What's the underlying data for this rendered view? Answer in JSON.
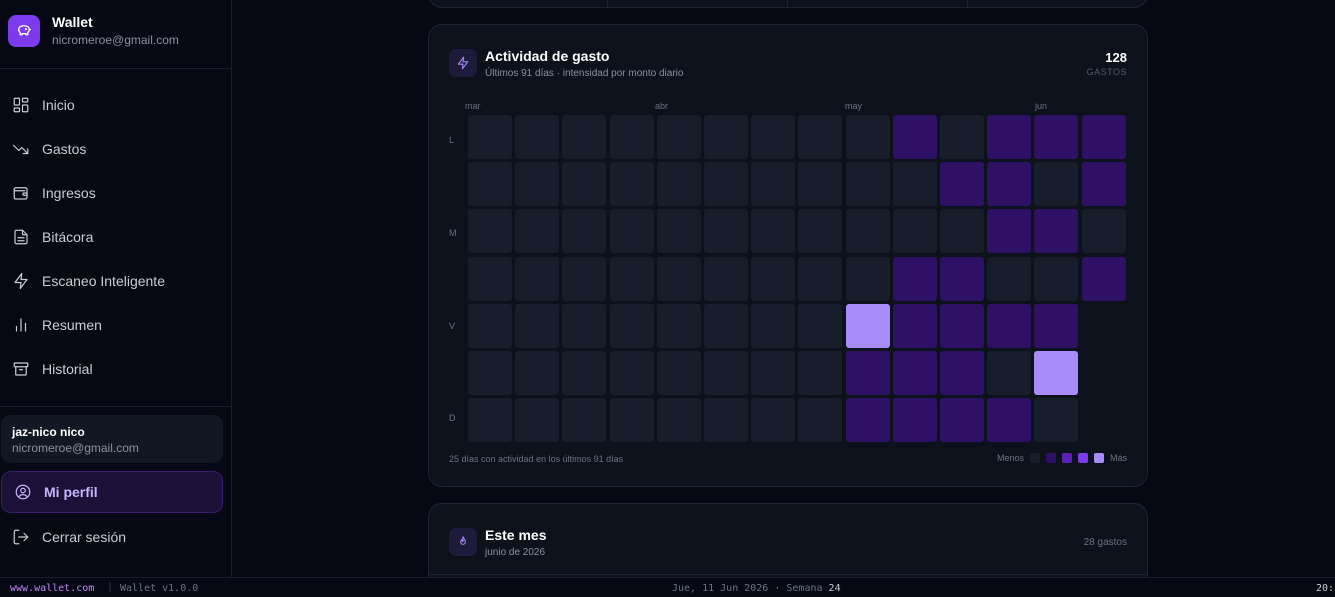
{
  "app": {
    "title": "Wallet",
    "email": "nicromeroe@gmail.com"
  },
  "nav": {
    "items": [
      {
        "label": "Inicio",
        "icon": "grid-icon"
      },
      {
        "label": "Gastos",
        "icon": "trending-down-icon"
      },
      {
        "label": "Ingresos",
        "icon": "wallet-icon"
      },
      {
        "label": "Bitácora",
        "icon": "file-text-icon"
      },
      {
        "label": "Escaneo Inteligente",
        "icon": "bolt-icon"
      },
      {
        "label": "Resumen",
        "icon": "bar-chart-icon"
      },
      {
        "label": "Historial",
        "icon": "archive-icon"
      }
    ]
  },
  "user": {
    "name": "jaz-nico nico",
    "email": "nicromeroe@gmail.com"
  },
  "profile_label": "Mi perfil",
  "logout_label": "Cerrar sesión",
  "activity": {
    "title": "Actividad de gasto",
    "subtitle": "Últimos 91 días · intensidad por monto diario",
    "count": "128",
    "count_label": "GASTOS",
    "months": [
      "mar",
      "abr",
      "may",
      "jun"
    ],
    "day_labels": [
      "L",
      "M",
      "V",
      "D"
    ],
    "footer": "25 días con actividad en los últimos 91 días",
    "legend_less": "Menos",
    "legend_more": "Más",
    "colors": {
      "empty": "#171d2a",
      "level1": "#2e1065",
      "level2": "#5b21b6",
      "level3": "#7c3aed",
      "level4": "#a78bfa"
    },
    "grid": [
      [
        0,
        0,
        0,
        0,
        0,
        0,
        0,
        0,
        0,
        1,
        0,
        1,
        1,
        1
      ],
      [
        0,
        0,
        0,
        0,
        0,
        0,
        0,
        0,
        0,
        0,
        1,
        1,
        0,
        1
      ],
      [
        0,
        0,
        0,
        0,
        0,
        0,
        0,
        0,
        0,
        0,
        0,
        1,
        1,
        0
      ],
      [
        0,
        0,
        0,
        0,
        0,
        0,
        0,
        0,
        0,
        1,
        1,
        0,
        0,
        1
      ],
      [
        0,
        0,
        0,
        0,
        0,
        0,
        0,
        0,
        4,
        1,
        1,
        1,
        1,
        -1
      ],
      [
        0,
        0,
        0,
        0,
        0,
        0,
        0,
        0,
        1,
        1,
        1,
        0,
        4,
        -1
      ],
      [
        0,
        0,
        0,
        0,
        0,
        0,
        0,
        0,
        1,
        1,
        1,
        1,
        0,
        -1
      ]
    ]
  },
  "month_card": {
    "title": "Este mes",
    "subtitle": "junio de 2026",
    "count": "28 gastos"
  },
  "statusbar": {
    "link": "www.wallet.com",
    "version": "Wallet v1.0.0",
    "date_prefix": "Jue, 11 Jun 2026 · Semana ",
    "week": "24",
    "time": "20:"
  }
}
